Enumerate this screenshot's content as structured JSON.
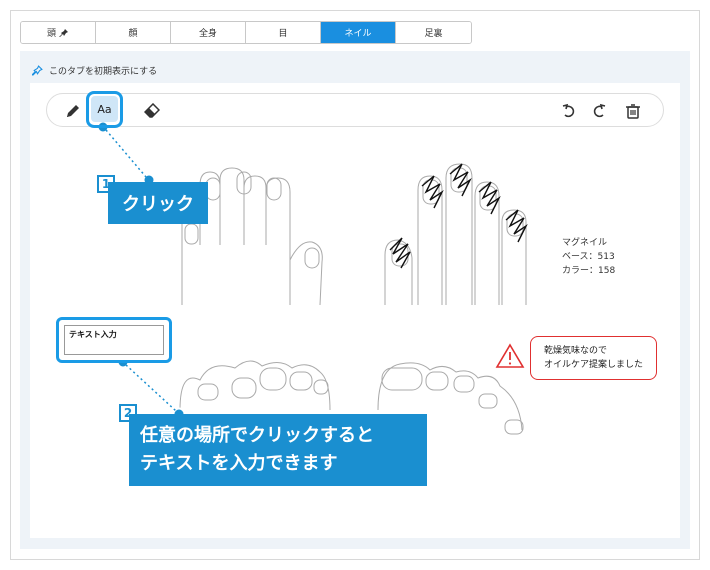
{
  "tabs": [
    {
      "label": "頭",
      "icon": "pin-icon",
      "active": false
    },
    {
      "label": "顔",
      "active": false
    },
    {
      "label": "全身",
      "active": false
    },
    {
      "label": "目",
      "active": false
    },
    {
      "label": "ネイル",
      "active": true
    },
    {
      "label": "足裏",
      "active": false
    }
  ],
  "pin_label": "このタブを初期表示にする",
  "toolbar": {
    "text_tool_label": "Aa"
  },
  "callout1": {
    "number": "1",
    "text": "クリック"
  },
  "text_input": {
    "value": "テキスト入力"
  },
  "callout2": {
    "number": "2",
    "line1": "任意の場所でクリックすると",
    "line2": "テキストを入力できます"
  },
  "nail_note": {
    "line1": "マグネイル",
    "line2": "ベース：513",
    "line3": "カラー：158"
  },
  "warning": {
    "line1": "乾燥気味なので",
    "line2": "オイルケア提案しました"
  },
  "colors": {
    "accent": "#1a8fe0",
    "callout": "#1a8fd0",
    "warning": "#e03030"
  }
}
